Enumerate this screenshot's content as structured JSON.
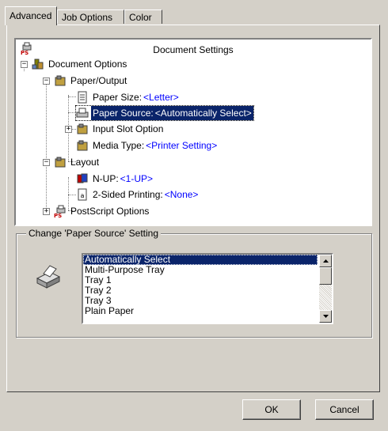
{
  "tabs": [
    {
      "label": "Advanced",
      "active": true
    },
    {
      "label": "Job Options",
      "active": false
    },
    {
      "label": "Color",
      "active": false
    }
  ],
  "tree": {
    "title": "Document Settings",
    "nodes": {
      "document_options": {
        "label": "Document Options"
      },
      "paper_output": {
        "label": "Paper/Output"
      },
      "paper_size": {
        "label": "Paper Size:",
        "value": "<Letter>"
      },
      "paper_source": {
        "label": "Paper Source:",
        "value": "<Automatically Select>"
      },
      "input_slot": {
        "label": "Input Slot Option"
      },
      "media_type": {
        "label": "Media Type:",
        "value": "<Printer Setting>"
      },
      "layout": {
        "label": "Layout"
      },
      "n_up": {
        "label": "N-UP:",
        "value": "<1-UP>"
      },
      "two_sided": {
        "label": "2-Sided Printing:",
        "value": "<None>"
      },
      "postscript": {
        "label": "PostScript Options"
      }
    }
  },
  "group": {
    "legend": "Change 'Paper Source' Setting",
    "options": [
      "Automatically Select",
      "Multi-Purpose Tray",
      "Tray 1",
      "Tray 2",
      "Tray 3",
      "Plain Paper"
    ],
    "selected": "Automatically Select"
  },
  "buttons": {
    "ok": "OK",
    "cancel": "Cancel"
  },
  "colors": {
    "selection": "#0a246a",
    "value_text": "#0000ff",
    "face": "#d4d0c8"
  }
}
